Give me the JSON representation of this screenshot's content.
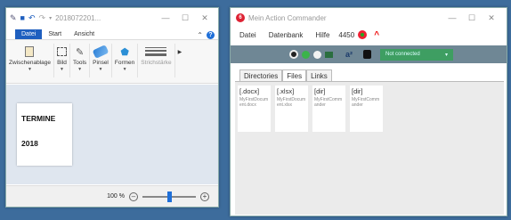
{
  "paint": {
    "title": "2018072201...",
    "tabs": [
      "Datei",
      "Start",
      "Ansicht"
    ],
    "ribbon_groups": [
      "Zwischenablage",
      "Bild",
      "Tools",
      "Pinsel",
      "Formen",
      "Strichstärke"
    ],
    "canvas_lines": [
      "TERMINE",
      "2018"
    ],
    "zoom": "100 %",
    "zoom_level": 0.5
  },
  "ac": {
    "title": "Mein Action Commander",
    "menu": [
      "Datei",
      "Datenbank",
      "Hilfe"
    ],
    "port": "4450",
    "connection_status": "Not connected",
    "tabs": [
      "Directories",
      "Files",
      "Links"
    ],
    "active_tab": "Files",
    "tiles": [
      {
        "type": "[.docx]",
        "name": "MyFirstDocument.docx"
      },
      {
        "type": "[.xlsx]",
        "name": "MyFirstDocument.xlsx"
      },
      {
        "type": "[dir]",
        "name": "MyFirstCommander"
      },
      {
        "type": "[dir]",
        "name": "MyFirstCommander"
      }
    ]
  },
  "colors": {
    "desktop": "#3d6c9c",
    "accent": "#1f5fbf",
    "toolbar": "#6f8795",
    "status_green": "#3e9e62",
    "record_red": "#e22233"
  }
}
